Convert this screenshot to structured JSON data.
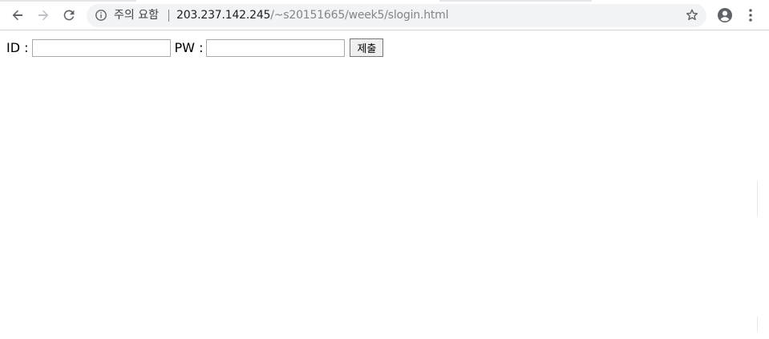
{
  "browser": {
    "omnibox": {
      "security_label": "주의 요함",
      "url_host": "203.237.142.245",
      "url_path": "/~s20151665/week5/slogin.html"
    },
    "icons": {
      "back": "back-arrow-icon",
      "forward": "forward-arrow-icon",
      "reload": "reload-icon",
      "info": "info-icon",
      "bookmark": "star-icon",
      "profile": "account-circle-icon",
      "menu": "kebab-menu-icon"
    }
  },
  "form": {
    "id_label": "ID :",
    "id_value": "",
    "pw_label": "PW :",
    "pw_value": "",
    "submit_label": "제출"
  },
  "colors": {
    "omnibox_bg": "#f1f3f4",
    "url_host": "#202124",
    "url_path": "#80868b",
    "icon": "#5f6368",
    "icon_disabled": "#bdc1c6"
  }
}
